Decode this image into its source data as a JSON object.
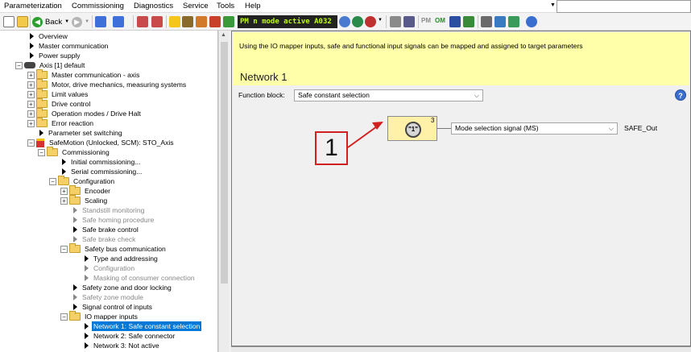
{
  "menu": {
    "items": [
      "Parameterization",
      "Commissioning",
      "Diagnostics",
      "Service",
      "Tools",
      "Help"
    ]
  },
  "toolbar": {
    "back_label": "Back",
    "status_display": "PM  n mode active  A032",
    "pm_label": "PM",
    "om_label": "OM"
  },
  "tree": {
    "items": [
      {
        "label": "Overview"
      },
      {
        "label": "Master communication"
      },
      {
        "label": "Power supply"
      },
      {
        "label": "Axis [1] default"
      },
      {
        "label": "Master communication - axis"
      },
      {
        "label": "Motor, drive mechanics, measuring systems"
      },
      {
        "label": "Limit values"
      },
      {
        "label": "Drive control"
      },
      {
        "label": "Operation modes / Drive Halt"
      },
      {
        "label": "Error reaction"
      },
      {
        "label": "Parameter set switching"
      },
      {
        "label": "SafeMotion (Unlocked, SCM): STO_Axis"
      },
      {
        "label": "Commissioning"
      },
      {
        "label": "Initial commissioning..."
      },
      {
        "label": "Serial commissioning..."
      },
      {
        "label": "Configuration"
      },
      {
        "label": "Encoder"
      },
      {
        "label": "Scaling"
      },
      {
        "label": "Standstill monitoring"
      },
      {
        "label": "Safe homing procedure"
      },
      {
        "label": "Safe brake control"
      },
      {
        "label": "Safe brake check"
      },
      {
        "label": "Safety bus communication"
      },
      {
        "label": "Type and addressing"
      },
      {
        "label": "Configuration"
      },
      {
        "label": "Masking of consumer connection"
      },
      {
        "label": "Safety zone and door locking"
      },
      {
        "label": "Safety zone module"
      },
      {
        "label": "Signal control of inputs"
      },
      {
        "label": "IO mapper inputs"
      },
      {
        "label": "Network 1: Safe constant selection"
      },
      {
        "label": "Network 2: Safe connector"
      },
      {
        "label": "Network 3: Not active"
      }
    ]
  },
  "main": {
    "info_text": "Using the IO mapper inputs, safe and functional input signals can be mapped and assigned to target parameters",
    "network_title": "Network 1",
    "function_block_label": "Function block:",
    "function_block_value": "Safe constant selection",
    "block_badge": "3",
    "block_symbol": "\"1\"",
    "signal_value": "Mode selection signal (MS)",
    "output_label": "SAFE_Out"
  },
  "callout": {
    "number": "1",
    "color": "#d21f1f"
  },
  "colors": {
    "selection": "#0078d7",
    "info_background": "#ffffa9",
    "block_background": "#fff2a8"
  }
}
